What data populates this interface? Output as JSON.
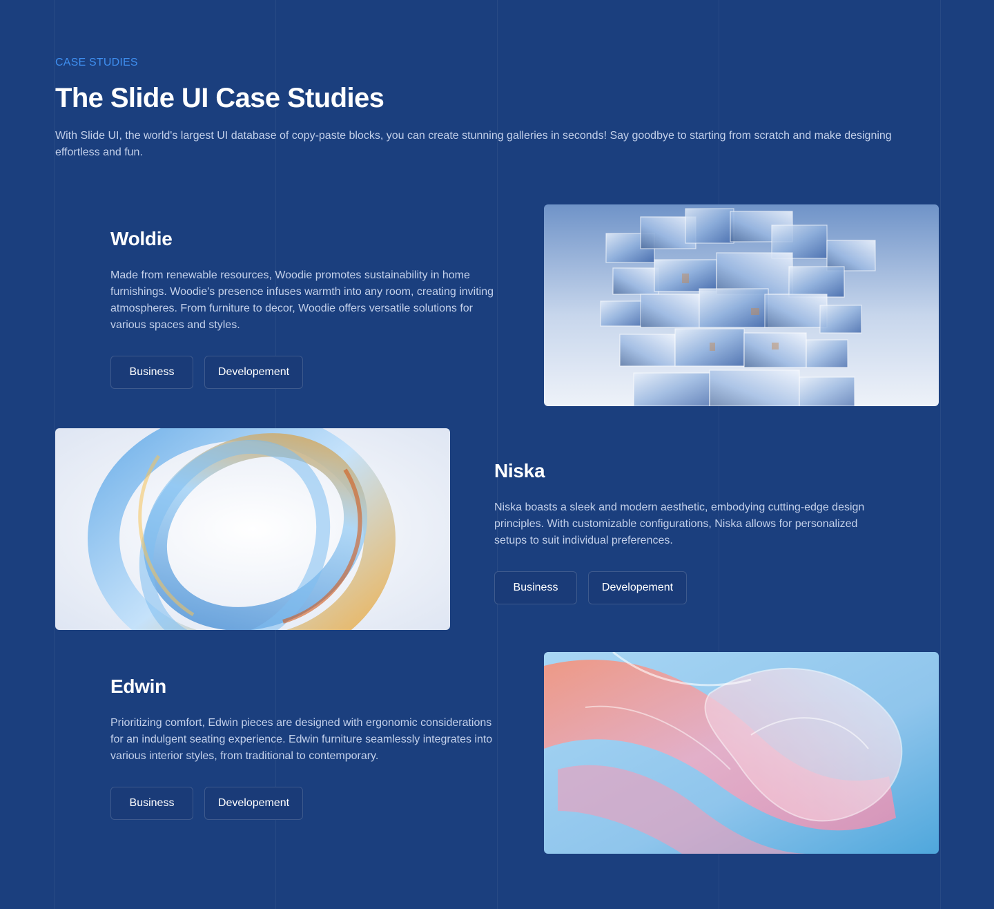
{
  "header": {
    "eyebrow": "CASE STUDIES",
    "title": "The Slide UI Case Studies",
    "intro": "With Slide UI, the world's largest UI database of copy-paste blocks, you can create stunning galleries in seconds! Say goodbye to starting from scratch and make designing effortless and fun."
  },
  "cases": [
    {
      "name": "Woldie",
      "description": "Made from renewable resources, Woodie promotes sustainability in home furnishings. Woodie's presence infuses warmth into any room, creating inviting atmospheres. From furniture to decor, Woodie offers versatile solutions for various spaces and styles.",
      "tags": [
        "Business",
        "Developement"
      ],
      "image": "glass-cubes-tower-image"
    },
    {
      "name": "Niska",
      "description": "Niska boasts a sleek and modern aesthetic, embodying cutting-edge design principles. With customizable configurations, Niska allows for personalized setups to suit individual preferences.",
      "tags": [
        "Business",
        "Developement"
      ],
      "image": "glass-ring-swirl-image"
    },
    {
      "name": "Edwin",
      "description": "Prioritizing comfort, Edwin pieces are designed with ergonomic considerations for an indulgent seating experience. Edwin furniture seamlessly integrates into various interior styles, from traditional to contemporary.",
      "tags": [
        "Business",
        "Developement"
      ],
      "image": "pink-glass-waves-image"
    }
  ],
  "colors": {
    "background": "#1b3f7e",
    "accent": "#3f8ff0",
    "heading": "#ffffff",
    "body_text": "#c3d0ea"
  }
}
